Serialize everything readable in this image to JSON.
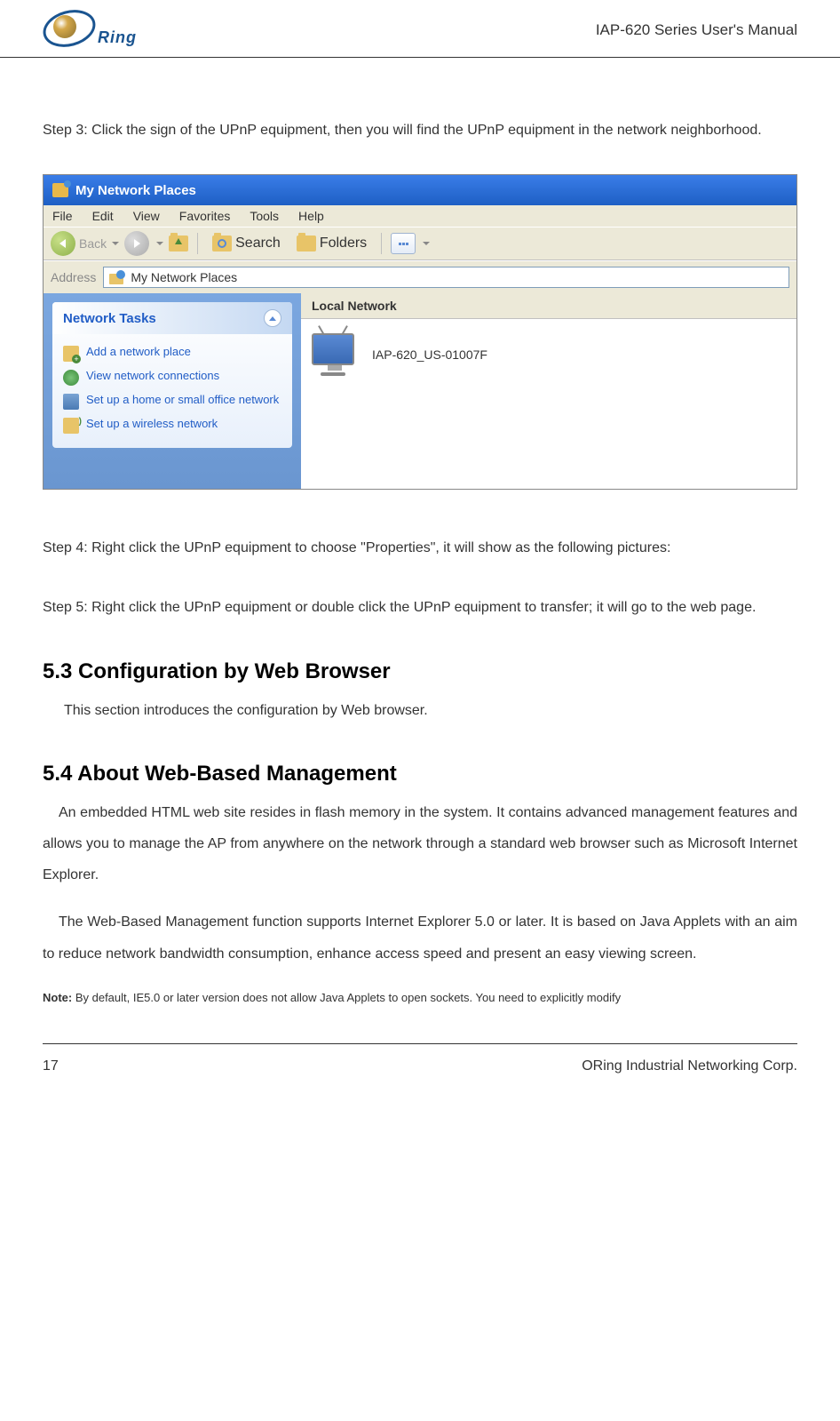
{
  "header": {
    "logo_text": "Ring",
    "title": "IAP-620 Series User's Manual"
  },
  "steps": {
    "step3": "Step 3: Click the sign of the UPnP equipment, then you will find the UPnP equipment in the network neighborhood.",
    "step4": "Step 4: Right click the UPnP equipment to choose \"Properties\", it will show as the following pictures:",
    "step5": "Step 5: Right click the UPnP equipment or double click the UPnP equipment to transfer; it will go to the web page."
  },
  "screenshot": {
    "titlebar": "My Network Places",
    "menu": {
      "file": "File",
      "edit": "Edit",
      "view": "View",
      "favorites": "Favorites",
      "tools": "Tools",
      "help": "Help"
    },
    "toolbar": {
      "back": "Back",
      "search": "Search",
      "folders": "Folders"
    },
    "address": {
      "label": "Address",
      "value": "My Network Places"
    },
    "sidebar": {
      "panel_title": "Network Tasks",
      "items": [
        "Add a network place",
        "View network connections",
        "Set up a home or small office network",
        "Set up a wireless network"
      ]
    },
    "main": {
      "section": "Local Network",
      "device": "IAP-620_US-01007F"
    }
  },
  "sections": {
    "s53_heading": "5.3    Configuration by Web Browser",
    "s53_intro": "This section introduces the configuration by Web browser.",
    "s54_heading": "5.4    About Web-Based Management",
    "s54_p1": "An embedded HTML web site resides in flash memory in the system.  It contains advanced management features and allows you to manage the AP from anywhere on the network through a standard web browser such as Microsoft Internet Explorer.",
    "s54_p2": "The Web-Based Management function supports Internet Explorer 5.0 or later.   It is based on Java Applets with an aim to reduce network bandwidth consumption, enhance access speed and present an easy viewing screen.",
    "note_label": "Note:",
    "note_text": " By default, IE5.0 or later version does not allow Java Applets to open sockets.   You need to explicitly modify"
  },
  "footer": {
    "page": "17",
    "company": "ORing Industrial Networking Corp."
  }
}
